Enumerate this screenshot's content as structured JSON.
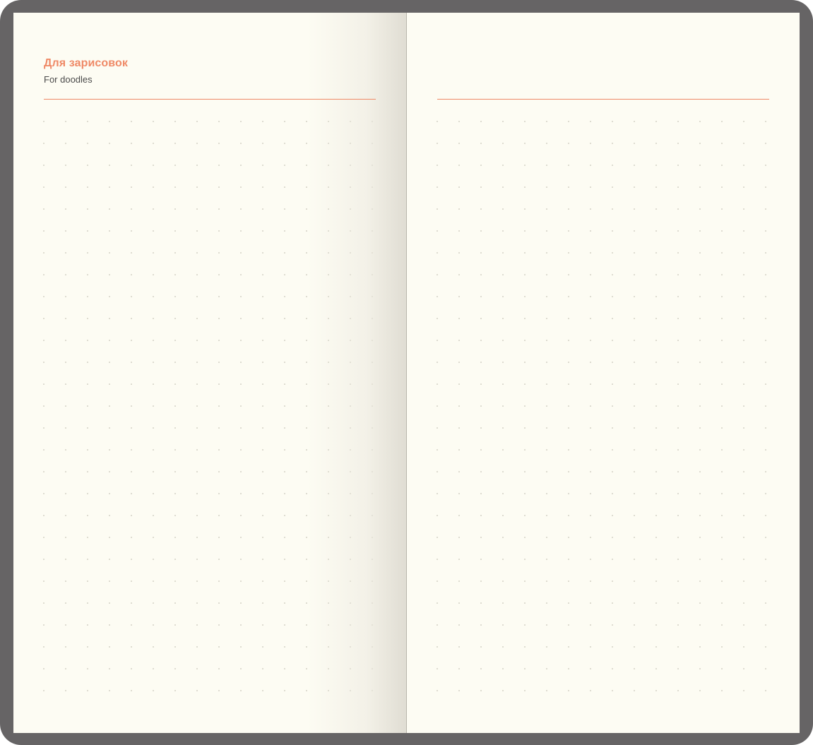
{
  "left_page": {
    "title": "Для зарисовок",
    "subtitle": "For doodles"
  },
  "right_page": {},
  "colors": {
    "accent": "#ef8a67",
    "paper": "#fdfcf3",
    "cover": "#666465",
    "dot": "#b8b6a8"
  }
}
